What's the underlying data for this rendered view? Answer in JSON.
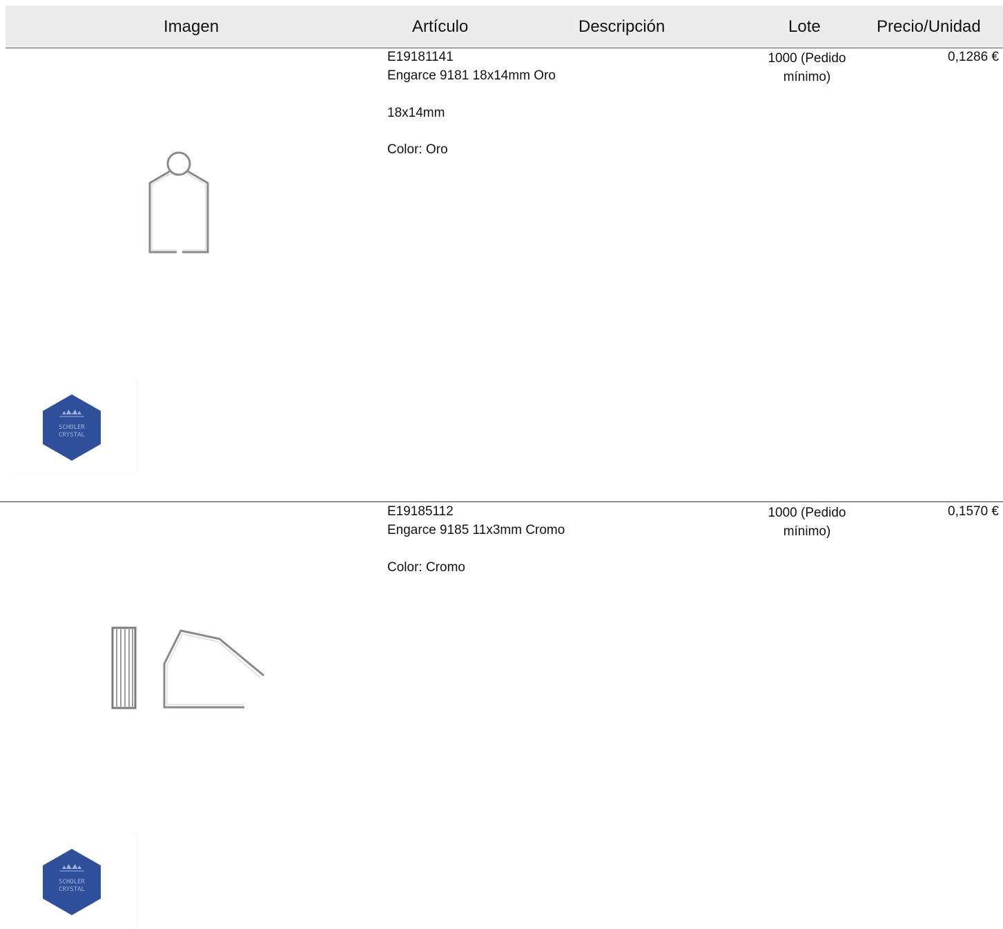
{
  "header": {
    "image": "Imagen",
    "article": "Artículo",
    "description": "Descripción",
    "lot": "Lote",
    "price_unit": "Precio/Unidad"
  },
  "products": [
    {
      "code": "E19181141",
      "name": "Engarce 9181 18x14mm Oro",
      "details": [
        "18x14mm",
        "Color: Oro"
      ],
      "lot": "1000 (Pedido mínimo)",
      "price": "0,1286 €",
      "image_icon": "wire-setting-icon"
    },
    {
      "code": "E19185112",
      "name": "Engarce 9185 11x3mm Cromo",
      "details": [
        "Color: Cromo"
      ],
      "lot": "1000 (Pedido mínimo)",
      "price": "0,1570 €",
      "image_icon": "wire-clip-icon"
    }
  ],
  "logo": {
    "line1": "SCHOLER",
    "line2": "CRYSTAL",
    "color": "#2f4f9a"
  }
}
